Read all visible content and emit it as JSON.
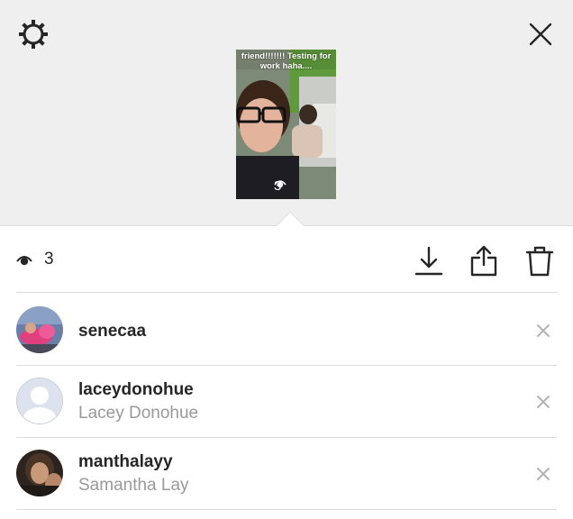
{
  "story": {
    "caption": "friend!!!!!!! Testing for work haha....",
    "view_count": "3"
  },
  "stats": {
    "view_count": "3"
  },
  "icons": {
    "settings": "gear-icon",
    "close": "close-icon",
    "views": "eye-icon",
    "download": "download-icon",
    "share": "share-icon",
    "delete": "trash-icon",
    "remove": "remove-x-icon"
  },
  "viewers": [
    {
      "username": "senecaa",
      "full_name": ""
    },
    {
      "username": "laceydonohue",
      "full_name": "Lacey Donohue"
    },
    {
      "username": "manthalayy",
      "full_name": "Samantha Lay"
    }
  ],
  "colors": {
    "top_background": "#efefef",
    "divider": "#dbdbdb",
    "primary_text": "#262626",
    "secondary_text": "#999999"
  }
}
